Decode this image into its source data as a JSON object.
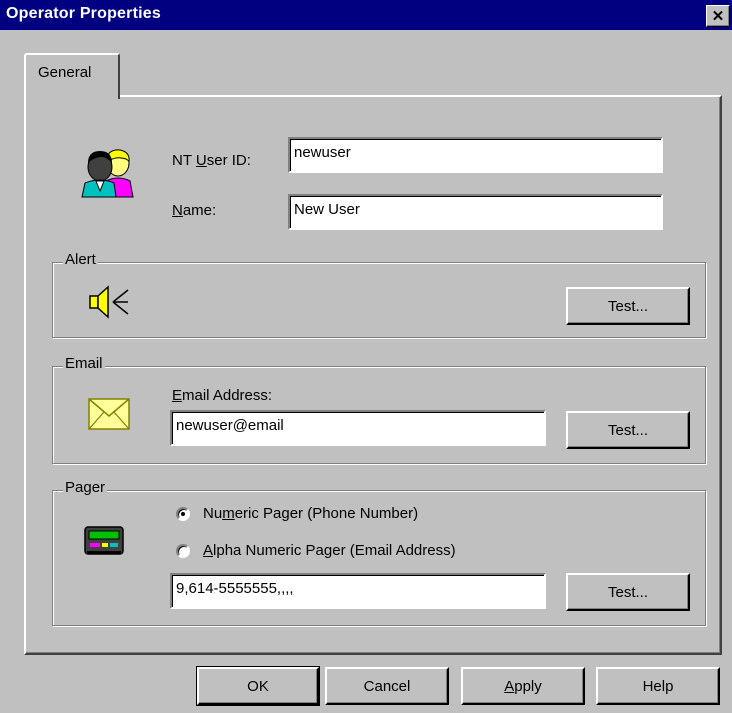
{
  "window": {
    "title": "Operator Properties",
    "close_glyph": "✕"
  },
  "tabs": [
    {
      "label": "General"
    }
  ],
  "user": {
    "nt_user_id_label": {
      "pre": "NT ",
      "key": "U",
      "post": "ser ID:"
    },
    "nt_user_id_value": "newuser",
    "name_label": {
      "key": "N",
      "post": "ame:"
    },
    "name_value": "New User"
  },
  "alert": {
    "legend": "Alert",
    "test_label": "Test..."
  },
  "email": {
    "legend": "Email",
    "address_label": {
      "key": "E",
      "post": "mail Address:"
    },
    "address_value": "newuser@email",
    "test_label": "Test..."
  },
  "pager": {
    "legend": "Pager",
    "numeric": {
      "pre": "Nu",
      "key": "m",
      "post": "eric Pager (Phone Number)",
      "checked": true
    },
    "alpha": {
      "key": "A",
      "post": "lpha Numeric Pager (Email Address)",
      "checked": false
    },
    "value": "9,614-5555555,,,,",
    "test_label": "Test..."
  },
  "footer": {
    "ok_label": "OK",
    "cancel_label": "Cancel",
    "apply_label": {
      "key": "A",
      "post": "pply"
    },
    "help_label": "Help"
  },
  "icons": {
    "users": "users-icon",
    "speaker": "speaker-icon",
    "envelope": "envelope-icon",
    "pager": "pager-icon"
  }
}
